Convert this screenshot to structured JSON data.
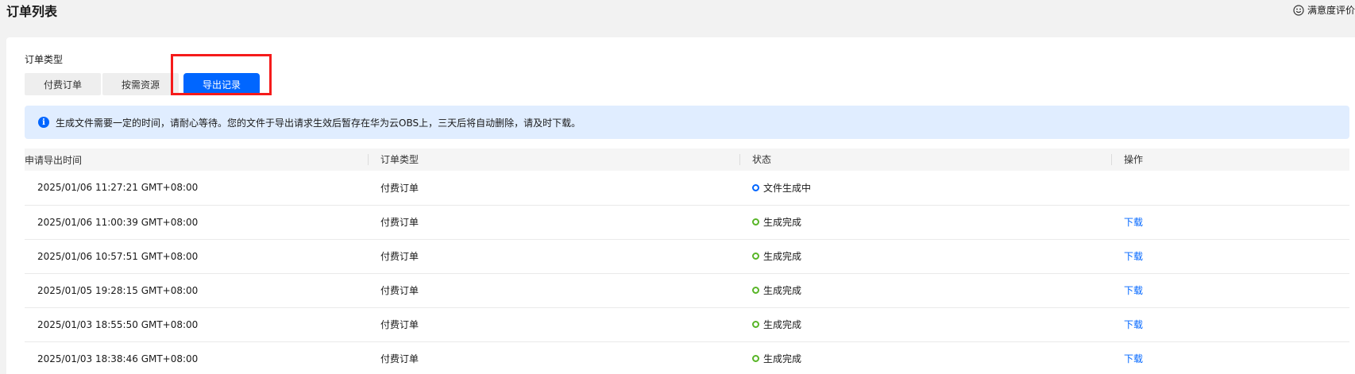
{
  "header": {
    "title": "订单列表",
    "feedback_label": "满意度评价"
  },
  "filter": {
    "label": "订单类型",
    "tabs": [
      {
        "label": "付费订单",
        "active": false
      },
      {
        "label": "按需资源",
        "active": false
      },
      {
        "label": "导出记录",
        "active": true
      }
    ]
  },
  "notice": {
    "text": "生成文件需要一定的时间，请耐心等待。您的文件于导出请求生效后暂存在华为云OBS上，三天后将自动删除，请及时下载。"
  },
  "table": {
    "columns": [
      "申请导出时间",
      "订单类型",
      "状态",
      "操作"
    ],
    "rows": [
      {
        "time": "2025/01/06 11:27:21 GMT+08:00",
        "type": "付费订单",
        "status": "文件生成中",
        "status_color": "#0066ff",
        "action": ""
      },
      {
        "time": "2025/01/06 11:00:39 GMT+08:00",
        "type": "付费订单",
        "status": "生成完成",
        "status_color": "#58b527",
        "action": "下载"
      },
      {
        "time": "2025/01/06 10:57:51 GMT+08:00",
        "type": "付费订单",
        "status": "生成完成",
        "status_color": "#58b527",
        "action": "下载"
      },
      {
        "time": "2025/01/05 19:28:15 GMT+08:00",
        "type": "付费订单",
        "status": "生成完成",
        "status_color": "#58b527",
        "action": "下载"
      },
      {
        "time": "2025/01/03 18:55:50 GMT+08:00",
        "type": "付费订单",
        "status": "生成完成",
        "status_color": "#58b527",
        "action": "下载"
      },
      {
        "time": "2025/01/03 18:38:46 GMT+08:00",
        "type": "付费订单",
        "status": "生成完成",
        "status_color": "#58b527",
        "action": "下载"
      }
    ]
  },
  "icons": {
    "feedback": "smile-icon",
    "notice": "info-icon"
  }
}
